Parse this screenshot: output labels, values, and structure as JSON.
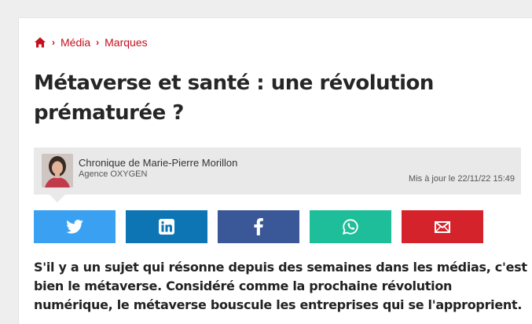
{
  "breadcrumb": {
    "home_icon": "home-icon",
    "items": [
      "Média",
      "Marques"
    ]
  },
  "article": {
    "title": "Métaverse et santé : une révolution prématurée ?",
    "intro": "S'il y a un sujet qui résonne depuis des semaines dans les médias, c'est bien le métaverse. Considéré comme la prochaine révolution numérique, le métaverse bouscule les entreprises qui se l'approprient."
  },
  "author": {
    "byline": "Chronique de Marie-Pierre Morillon",
    "agency": "Agence OXYGEN",
    "updated": "Mis à jour le 22/11/22 15:49"
  },
  "share": [
    {
      "name": "twitter",
      "icon": "twitter-icon",
      "color": "#3aa1f2"
    },
    {
      "name": "linkedin",
      "icon": "linkedin-icon",
      "color": "#0e75b4"
    },
    {
      "name": "facebook",
      "icon": "facebook-icon",
      "color": "#3a5897"
    },
    {
      "name": "whatsapp",
      "icon": "whatsapp-icon",
      "color": "#1fbe9a"
    },
    {
      "name": "email",
      "icon": "mail-icon",
      "color": "#d5232b"
    }
  ],
  "colors": {
    "accent": "#c40f1e",
    "title": "#262626",
    "author_bg": "#e9e9e9"
  }
}
